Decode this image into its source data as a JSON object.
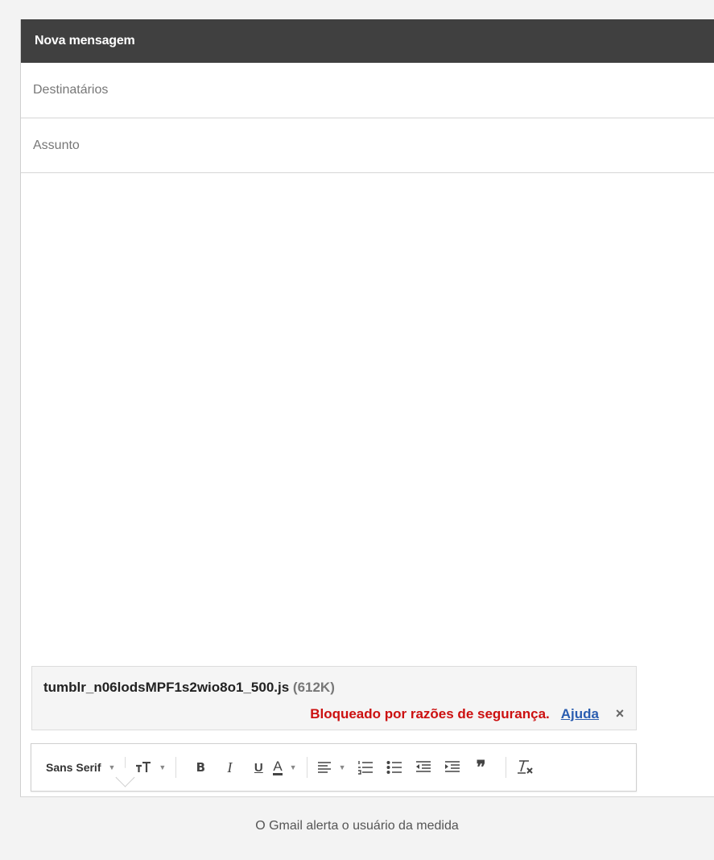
{
  "compose": {
    "title": "Nova mensagem",
    "recipients_placeholder": "Destinatários",
    "subject_placeholder": "Assunto"
  },
  "attachment": {
    "filename": "tumblr_n06lodsMPF1s2wio8o1_500.js",
    "size": "(612K)",
    "warning": "Bloqueado por razões de segurança.",
    "help_link": "Ajuda",
    "close": "×"
  },
  "toolbar": {
    "font": "Sans Serif",
    "bold": "B",
    "italic": "I",
    "underline": "U",
    "text_color": "A",
    "quote": "❞",
    "icons": [
      "font-size-icon",
      "align-icon",
      "numbered-list-icon",
      "bulleted-list-icon",
      "indent-less-icon",
      "indent-more-icon",
      "quote-icon",
      "remove-formatting-icon"
    ]
  },
  "caption": "O Gmail alerta o usuário da medida",
  "colors": {
    "titlebar": "#404040",
    "warning": "#cc1010",
    "link": "#2a5db0"
  }
}
